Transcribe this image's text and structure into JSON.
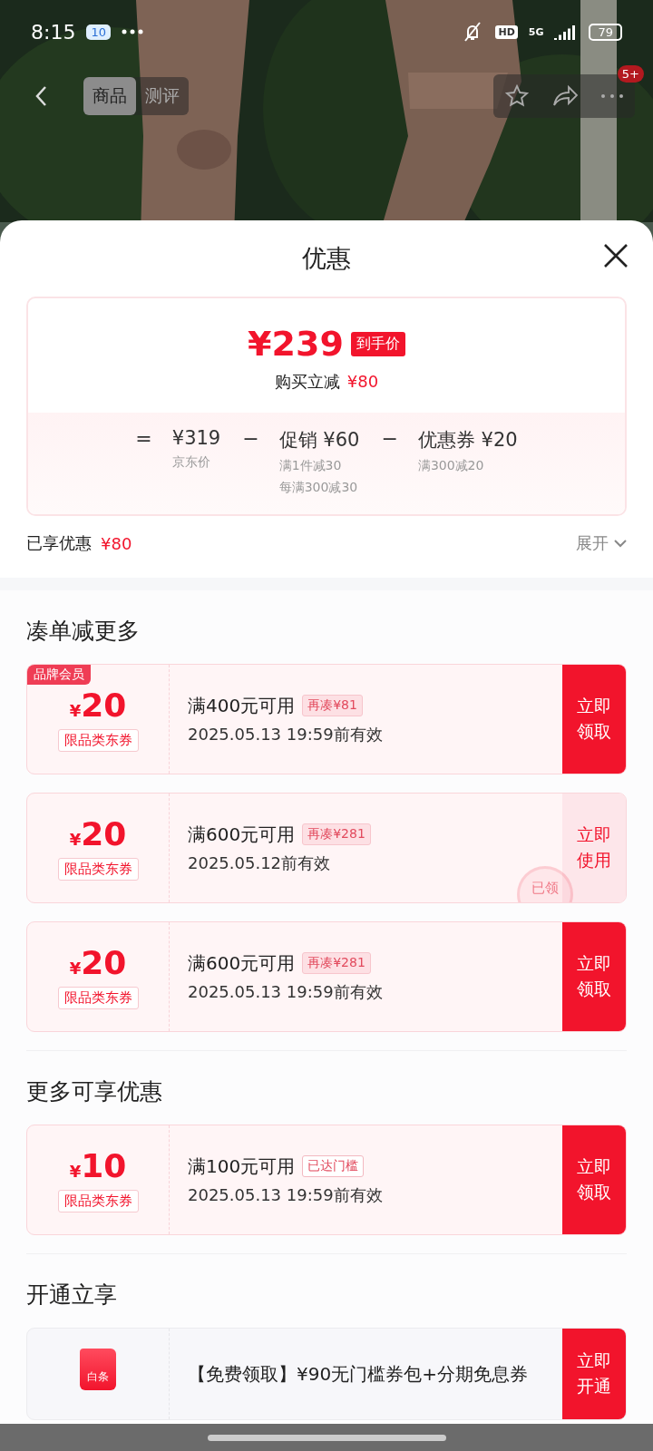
{
  "status_bar": {
    "time": "8:15",
    "notification_badge": "10",
    "network": "5G",
    "hd": "HD",
    "battery": "79"
  },
  "header": {
    "tabs": [
      {
        "label": "商品",
        "selected": true
      },
      {
        "label": "测评",
        "selected": false
      }
    ],
    "more_badge": "5+"
  },
  "sheet": {
    "title": "优惠"
  },
  "summary": {
    "final_price": "¥239",
    "final_price_tag": "到手价",
    "instant_label": "购买立减",
    "instant_amount": "¥80",
    "breakdown": [
      {
        "operator": "=",
        "amount": "¥319",
        "notes": [
          "京东价"
        ]
      },
      {
        "operator": "−",
        "amount": "促销 ¥60",
        "notes": [
          "满1件减30",
          "每满300减30"
        ]
      },
      {
        "operator": "−",
        "amount": "优惠券 ¥20",
        "notes": [
          "满300减20"
        ]
      }
    ]
  },
  "enjoyed": {
    "label": "已享优惠",
    "amount": "¥80",
    "toggle": "展开",
    "expanded": false
  },
  "sections": [
    {
      "title": "凑单减更多",
      "items": [
        {
          "kind": "coupon",
          "badge": "品牌会员",
          "currency": "¥",
          "amount": "20",
          "scope": "限品类东券",
          "condition": "满400元可用",
          "tag": {
            "text": "再凑¥81",
            "kind": "shortfall"
          },
          "validity": "2025.05.13 19:59前有效",
          "action": "立即领取",
          "claimed": false
        },
        {
          "kind": "coupon",
          "currency": "¥",
          "amount": "20",
          "scope": "限品类东券",
          "condition": "满600元可用",
          "tag": {
            "text": "再凑¥281",
            "kind": "shortfall"
          },
          "validity": "2025.05.12前有效",
          "action": "立即使用",
          "claimed": true,
          "stamp": "已领"
        },
        {
          "kind": "coupon",
          "currency": "¥",
          "amount": "20",
          "scope": "限品类东券",
          "condition": "满600元可用",
          "tag": {
            "text": "再凑¥281",
            "kind": "shortfall"
          },
          "validity": "2025.05.13 19:59前有效",
          "action": "立即领取",
          "claimed": false
        }
      ]
    },
    {
      "title": "更多可享优惠",
      "items": [
        {
          "kind": "coupon",
          "currency": "¥",
          "amount": "10",
          "scope": "限品类东券",
          "condition": "满100元可用",
          "tag": {
            "text": "已达门槛",
            "kind": "reached"
          },
          "validity": "2025.05.13 19:59前有效",
          "action": "立即领取",
          "claimed": false
        }
      ]
    },
    {
      "title": "开通立享",
      "items": [
        {
          "kind": "service",
          "icon_label": "白条",
          "description": "【免费领取】¥90无门槛券包+分期免息券",
          "action": "立即开通"
        }
      ]
    }
  ]
}
